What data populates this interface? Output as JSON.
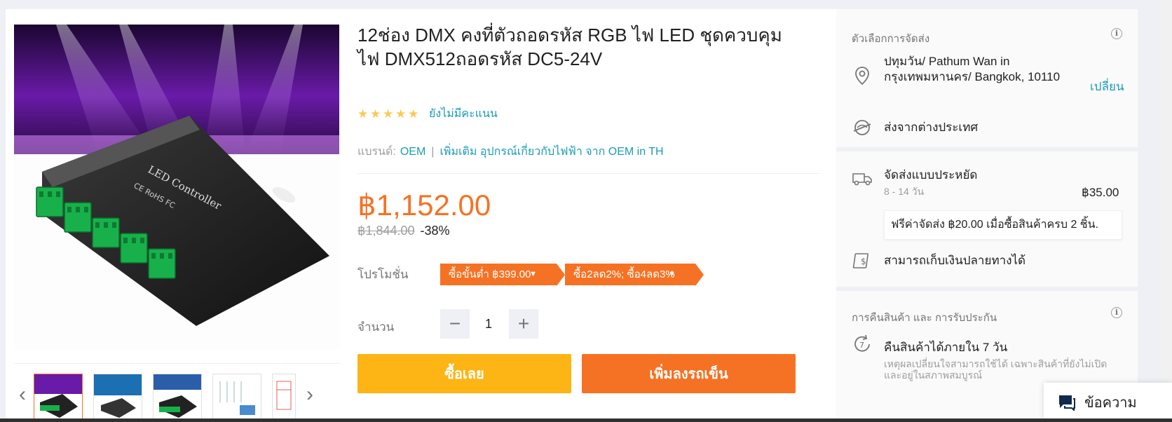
{
  "product": {
    "title": "12ช่อง DMX คงที่ตัวถอดรหัส RGB ไฟ LED ชุดควบคุมไฟ DMX512ถอดรหัส DC5-24V",
    "rating_text": "ยังไม่มีคะแนน",
    "brand_label": "แบรนด์:",
    "brand_name": "OEM",
    "brand_more": "เพิ่มเติม อุปกรณ์เกี่ยวกับไฟฟ้า จาก OEM in TH",
    "price": "฿1,152.00",
    "original_price": "฿1,844.00",
    "discount": "-38%",
    "image_device_text": "LED Controller",
    "image_device_sub": "CE RoHS FC"
  },
  "promotion": {
    "label": "โปรโมชั่น",
    "tags": [
      "ซื้อขั้นต่ำ ฿399.00",
      "ซื้อ2ลด2%; ซื้อ4ลด3%"
    ]
  },
  "quantity": {
    "label": "จำนวน",
    "value": "1",
    "minus": "−",
    "plus": "+"
  },
  "actions": {
    "buy_now": "ซื้อเลย",
    "add_to_cart": "เพิ่มลงรถเข็น"
  },
  "delivery": {
    "section_title": "ตัวเลือกการจัดส่ง",
    "location": "ปทุมวัน/ Pathum Wan in กรุงเทพมหานคร/ Bangkok, 10110",
    "change": "เปลี่ยน",
    "overseas": "ส่งจากต่างประเทศ",
    "economy_title": "จัดส่งแบบประหยัด",
    "economy_days": "8 - 14 วัน",
    "economy_price": "฿35.00",
    "free_shipping_note": "ฟรีค่าจัดส่ง ฿20.00 เมื่อซื้อสินค้าครบ 2 ชิ้น.",
    "cod": "สามารถเก็บเงินปลายทางได้"
  },
  "returns": {
    "section_title": "การคืนสินค้า และ การรับประกัน",
    "return_title": "คืนสินค้าได้ภายใน 7 วัน",
    "return_desc": "เหตุผลเปลี่ยนใจสามารถใช้ได้ เฉพาะสินค้าที่ยังไม่เปิดและอยู่ในสภาพสมบูรณ์"
  },
  "chat": {
    "label": "ข้อความ"
  },
  "colors": {
    "accent": "#f57224",
    "buy": "#fcb515",
    "link": "#1a9cb7"
  },
  "icons": {
    "star": "★",
    "caret": "▼",
    "chevron_left": "‹",
    "chevron_right": "›"
  }
}
